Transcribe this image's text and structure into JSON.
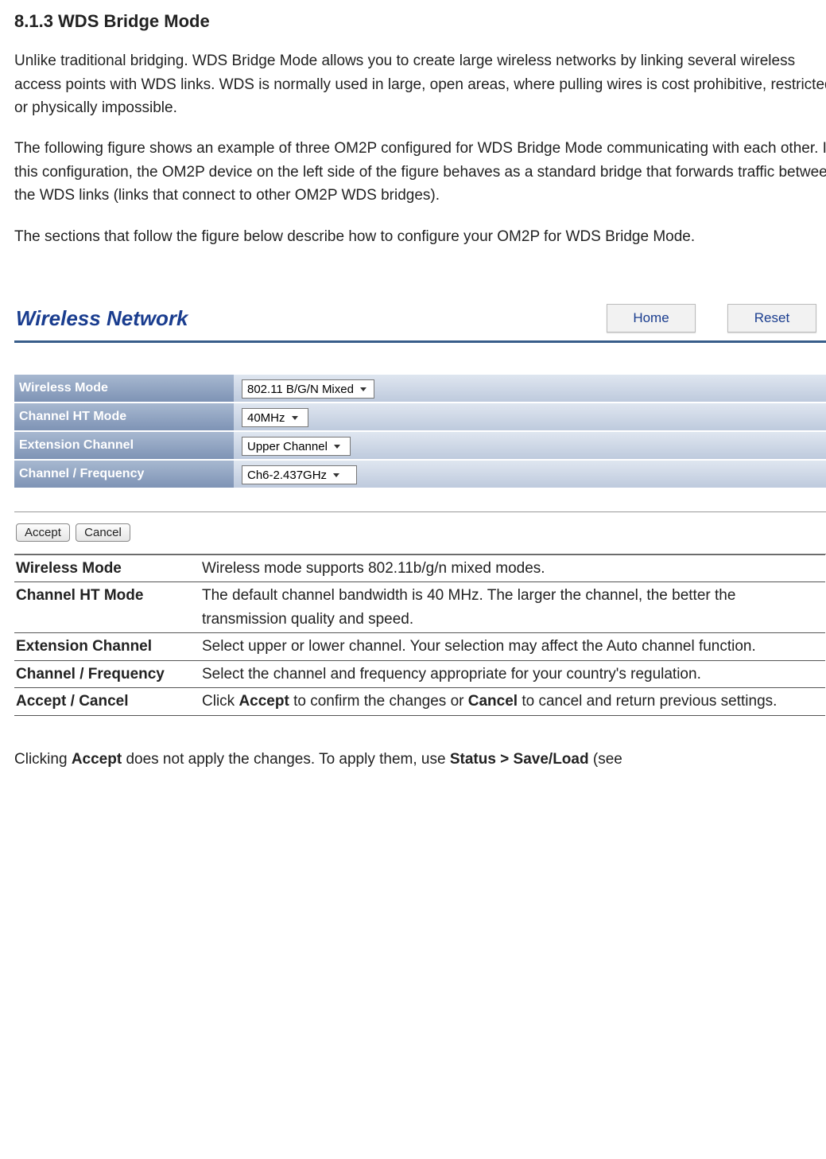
{
  "heading": "8.1.3 WDS Bridge Mode",
  "paragraphs": [
    "Unlike traditional bridging. WDS Bridge Mode allows you to create large wireless networks by linking several wireless access points with WDS links. WDS is normally used in large, open areas, where pulling wires is cost prohibitive, restricted or physically impossible.",
    "The following figure shows an example of three OM2P configured for WDS Bridge Mode communicating with each other. In this configuration, the OM2P device on the left side of the figure behaves as a standard bridge that forwards traffic between the WDS links (links that connect to other OM2P WDS bridges).",
    "The sections that follow the figure below describe how to configure your OM2P for WDS Bridge Mode."
  ],
  "figure": {
    "title": "Wireless Network",
    "topButtons": {
      "home": "Home",
      "reset": "Reset"
    },
    "rows": {
      "wirelessMode": {
        "label": "Wireless Mode",
        "value": "802.11 B/G/N Mixed"
      },
      "channelHtMode": {
        "label": "Channel HT Mode",
        "value": "40MHz"
      },
      "extensionChannel": {
        "label": "Extension Channel",
        "value": "Upper Channel"
      },
      "channelFrequency": {
        "label": "Channel / Frequency",
        "value": "Ch6-2.437GHz"
      }
    },
    "bottomButtons": {
      "accept": "Accept",
      "cancel": "Cancel"
    }
  },
  "descTable": [
    {
      "label": "Wireless Mode",
      "text": "Wireless mode supports 802.11b/g/n mixed modes."
    },
    {
      "label": "Channel HT Mode",
      "text": "The default channel bandwidth is 40 MHz. The larger the channel, the better the transmission quality and speed."
    },
    {
      "label": "Extension Channel",
      "text": "Select upper or lower channel. Your selection may affect the Auto channel function."
    },
    {
      "label": "Channel / Frequency",
      "text": "Select the channel and frequency appropriate for your country's regulation."
    }
  ],
  "acceptCancel": {
    "label": "Accept / Cancel",
    "pre": "Click ",
    "b1": "Accept",
    "mid": " to confirm the changes or ",
    "b2": "Cancel",
    "post": " to cancel and return previous settings."
  },
  "note": {
    "pre": "Clicking ",
    "b1": "Accept",
    "mid": " does not apply the changes. To apply them, use ",
    "b2": "Status > Save/Load",
    "post": " (see"
  }
}
